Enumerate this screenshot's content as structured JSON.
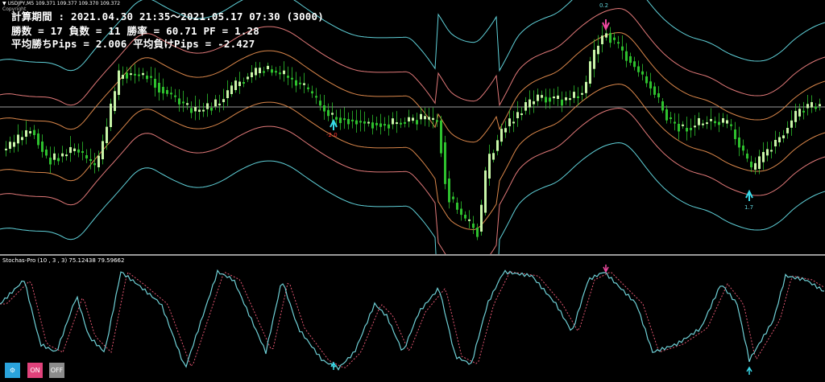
{
  "chart": {
    "symbol_line": "▼ USDJPY,M5  109.371 109.377 109.370 109.372",
    "copyright": "Copyright",
    "stats": {
      "line1": "計算期間 : 2021.04.30 21:35〜2021.05.17 07:30 (3000)",
      "line2": "勝数 = 17 負数 = 11 勝率 = 60.71 PF = 1.28",
      "line3": "平均勝ちPips = 2.006  平均負けPips = -2.427"
    },
    "markers": {
      "top_value": "0.2",
      "left_value": "-2.0",
      "right_value": "1.7"
    }
  },
  "indicator": {
    "label": "Stochas-Pro (10 , 3 , 3) 75.12438 79.59662"
  },
  "buttons": {
    "gear": "⚙",
    "on": "ON",
    "off": "OFF"
  },
  "colors": {
    "background": "#000000",
    "bull_candle": "#c8f5a8",
    "bear_candle": "#2ec12e",
    "band_outer": "#5fd0d8",
    "band_mid": "#e07878",
    "band_inner": "#d9864a",
    "price_line": "#9a9a9a",
    "stoch_main": "#6fd0d6",
    "stoch_signal": "#e05570",
    "buy_arrow": "#38d8e8",
    "sell_arrow": "#f04aa0",
    "btn_gear": "#2aa3dc",
    "btn_on": "#e0427b",
    "btn_off": "#8c8c8c"
  }
}
